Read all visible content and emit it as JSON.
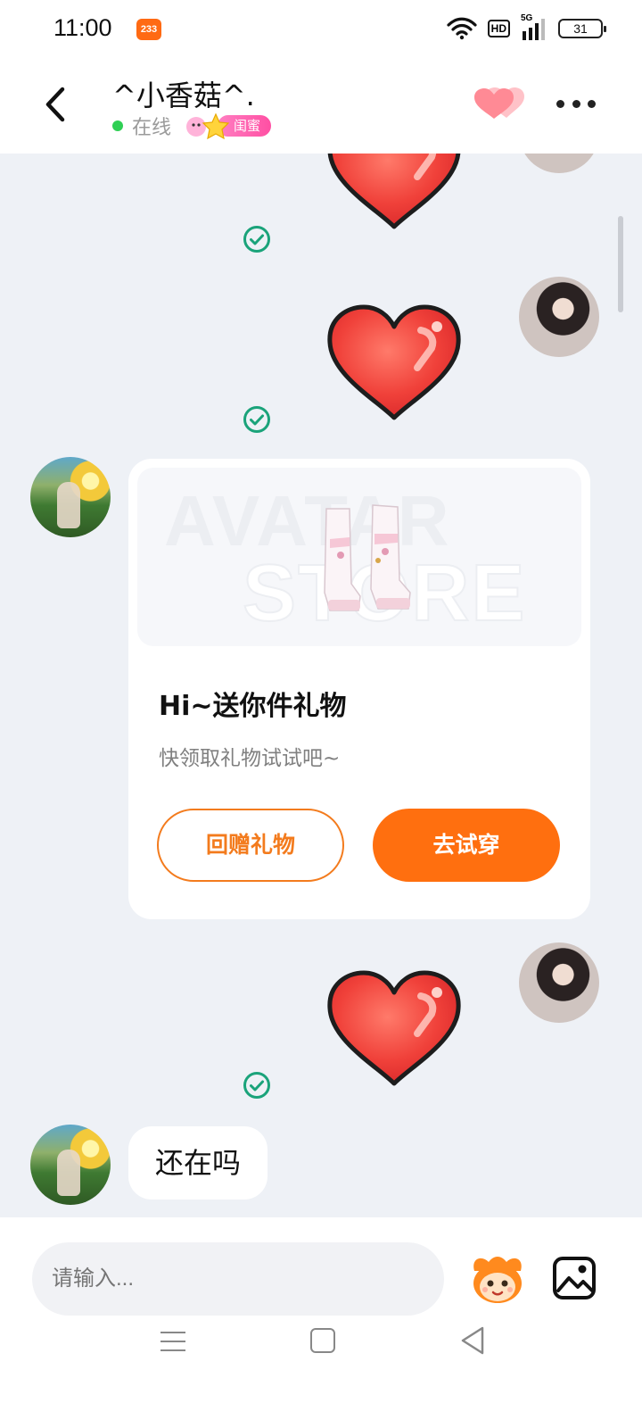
{
  "status_bar": {
    "time": "11:00",
    "notification_badge": "233",
    "hd_label": "HD",
    "network_label": "5G",
    "battery_level": "31"
  },
  "header": {
    "contact_name": "^小香菇^.",
    "online_status": "在线",
    "relationship_badge": "闺蜜",
    "icons": [
      "back-arrow-icon",
      "hearts-icon",
      "more-options-icon"
    ]
  },
  "chat": {
    "messages": [
      {
        "sender": "me",
        "type": "heart-sticker",
        "status": "sent"
      },
      {
        "sender": "me",
        "type": "heart-sticker",
        "status": "sent"
      },
      {
        "sender": "other",
        "type": "gift-card"
      },
      {
        "sender": "me",
        "type": "heart-sticker",
        "status": "sent"
      },
      {
        "sender": "other",
        "type": "text"
      }
    ],
    "gift_card": {
      "watermark_line1": "AVATAR",
      "watermark_line2": "STORE",
      "title": "Hi~送你件礼物",
      "subtitle": "快领取礼物试试吧~",
      "return_gift_label": "回赠礼物",
      "try_on_label": "去试穿"
    },
    "last_text_message": "还在吗"
  },
  "input_bar": {
    "placeholder": "请输入..."
  },
  "colors": {
    "accent_orange": "#ff6f0f",
    "online_green": "#2fcf54",
    "badge_pink": "#ff4fa3",
    "sent_check": "#1aa37a",
    "heart_red": "#f0413a"
  }
}
